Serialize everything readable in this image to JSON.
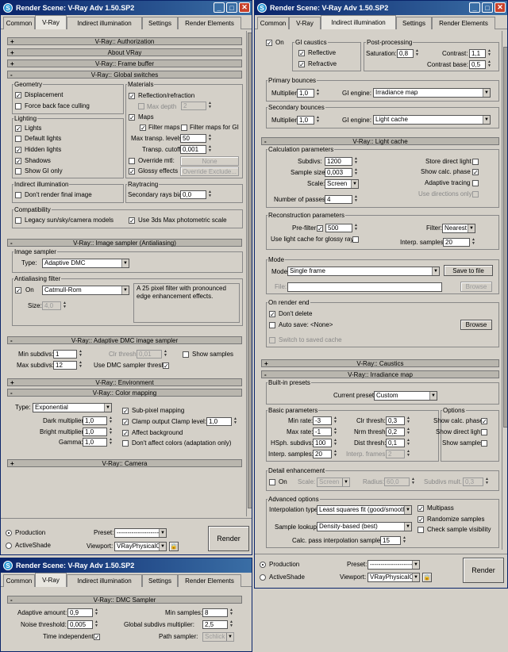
{
  "windows": {
    "title": "Render Scene: V-Ray Adv 1.50.SP2"
  },
  "tabs": [
    "Common",
    "V-Ray",
    "Indirect illumination",
    "Settings",
    "Render Elements"
  ],
  "left": {
    "rollouts": {
      "authorization": "V-Ray:: Authorization",
      "about": "About VRay",
      "framebuffer": "V-Ray:: Frame buffer",
      "global": "V-Ray:: Global switches",
      "imagesampler": "V-Ray:: Image sampler (Antialiasing)",
      "adaptive": "V-Ray:: Adaptive DMC image sampler",
      "environment": "V-Ray:: Environment",
      "colormapping": "V-Ray:: Color mapping",
      "camera": "V-Ray:: Camera"
    },
    "geometry": {
      "label": "Geometry",
      "displacement": "Displacement",
      "force_backface": "Force back face culling"
    },
    "materials": {
      "label": "Materials",
      "reflection": "Reflection/refraction",
      "max_depth": "Max depth",
      "max_depth_val": "2",
      "maps": "Maps",
      "filter_maps": "Filter maps",
      "filter_maps_gi": "Filter maps for GI",
      "max_transp_levels": "Max transp. levels",
      "max_transp_val": "50",
      "transp_cutoff": "Transp. cutoff",
      "transp_cutoff_val": "0,001",
      "override_mtl": "Override mtl:",
      "none": "None",
      "glossy": "Glossy effects",
      "override_exclude": "Override Exclude..."
    },
    "lighting": {
      "label": "Lighting",
      "lights": "Lights",
      "default_lights": "Default lights",
      "hidden_lights": "Hidden lights",
      "shadows": "Shadows",
      "show_gi_only": "Show GI only"
    },
    "indirect": {
      "label": "Indirect illumination",
      "dont_render": "Don't render final image"
    },
    "raytracing": {
      "label": "Raytracing",
      "secondary_bias": "Secondary rays bias",
      "secondary_bias_val": "0,0"
    },
    "compat": {
      "label": "Compatibility",
      "legacy": "Legacy sun/sky/camera models",
      "use_3ds": "Use 3ds Max photometric scale"
    },
    "imgsampler": {
      "label": "Image sampler",
      "type_label": "Type:",
      "type_val": "Adaptive DMC"
    },
    "aa": {
      "label": "Antialiasing filter",
      "on": "On",
      "filter": "Catmull-Rom",
      "desc": "A 25 pixel filter with pronounced edge enhancement effects.",
      "size_label": "Size:",
      "size_val": "4,0"
    },
    "adaptive": {
      "min_subdivs": "Min subdivs:",
      "min_subdivs_val": "1",
      "max_subdivs": "Max subdivs:",
      "max_subdivs_val": "12",
      "clr_thresh": "Clr thresh:",
      "clr_thresh_val": "0,01",
      "use_dmc": "Use DMC sampler thresh.",
      "show_samples": "Show samples"
    },
    "colormap": {
      "type_label": "Type:",
      "type_val": "Exponential",
      "dark": "Dark multiplier:",
      "dark_val": "1,0",
      "bright": "Bright multiplier:",
      "bright_val": "1,0",
      "gamma": "Gamma:",
      "gamma_val": "1,0",
      "subpixel": "Sub-pixel mapping",
      "clamp": "Clamp output",
      "clamp_level": "Clamp level:",
      "clamp_level_val": "1,0",
      "affect_bg": "Affect background",
      "dont_affect": "Don't affect colors (adaptation only)"
    }
  },
  "bottom": {
    "production": "Production",
    "activeshade": "ActiveShade",
    "preset": "Preset:",
    "preset_val": "---------------------------",
    "viewport": "Viewport:",
    "viewport_val": "VRayPhysicalC",
    "render": "Render"
  },
  "dmc": {
    "rollout": "V-Ray:: DMC Sampler",
    "adaptive_amount": "Adaptive amount:",
    "adaptive_amount_val": "0,9",
    "noise_threshold": "Noise threshold:",
    "noise_threshold_val": "0,005",
    "time_independent": "Time independent",
    "min_samples": "Min samples:",
    "min_samples_val": "8",
    "global_subdivs": "Global subdivs multiplier:",
    "global_subdivs_val": "2,5",
    "path_sampler": "Path sampler:",
    "path_sampler_val": "Schlick sampling"
  },
  "right": {
    "on": "On",
    "gi_caustics": {
      "label": "GI caustics",
      "reflective": "Reflective",
      "refractive": "Refractive"
    },
    "post": {
      "label": "Post-processing",
      "saturation": "Saturation:",
      "saturation_val": "0,8",
      "contrast": "Contrast:",
      "contrast_val": "1,1",
      "contrast_base": "Contrast base:",
      "contrast_base_val": "0,5"
    },
    "primary": {
      "label": "Primary bounces",
      "multiplier": "Multiplier:",
      "multiplier_val": "1,0",
      "gi_engine": "GI engine:",
      "engine_val": "Irradiance map"
    },
    "secondary": {
      "label": "Secondary bounces",
      "multiplier": "Multiplier:",
      "multiplier_val": "1,0",
      "gi_engine": "GI engine:",
      "engine_val": "Light cache"
    },
    "lightcache": {
      "rollout": "V-Ray:: Light cache",
      "calc_label": "Calculation parameters",
      "subdivs": "Subdivs:",
      "subdivs_val": "1200",
      "sample_size": "Sample size:",
      "sample_size_val": "0,003",
      "scale": "Scale:",
      "scale_val": "Screen",
      "num_passes": "Number of passes:",
      "num_passes_val": "4",
      "store_direct": "Store direct light",
      "show_calc": "Show calc. phase",
      "adaptive_tracing": "Adaptive tracing",
      "use_directions": "Use directions only",
      "recon_label": "Reconstruction parameters",
      "prefilter": "Pre-filter:",
      "prefilter_val": "500",
      "use_lc_glossy": "Use light cache for glossy rays",
      "filter": "Filter:",
      "filter_val": "Nearest",
      "interp_samples": "Interp. samples:",
      "interp_samples_val": "20",
      "mode_label": "Mode",
      "mode": "Mode:",
      "mode_val": "Single frame",
      "save_to_file": "Save to file",
      "file": "File:",
      "browse": "Browse",
      "on_end_label": "On render end",
      "dont_delete": "Don't delete",
      "auto_save": "Auto save:",
      "auto_save_val": "<None>",
      "switch_saved": "Switch to saved cache"
    },
    "caustics_rollout": "V-Ray:: Caustics",
    "irradiance": {
      "rollout": "V-Ray:: Irradiance map",
      "builtin_label": "Built-in presets",
      "current_preset": "Current preset:",
      "preset_val": "Custom",
      "basic_label": "Basic parameters",
      "min_rate": "Min rate:",
      "min_rate_val": "-3",
      "max_rate": "Max rate:",
      "max_rate_val": "-1",
      "hsph": "HSph. subdivs:",
      "hsph_val": "100",
      "interp_samples": "Interp. samples:",
      "interp_samples_val": "20",
      "clr_thresh": "Clr thresh:",
      "clr_thresh_val": "0,3",
      "nrm_thresh": "Nrm thresh:",
      "nrm_thresh_val": "0,2",
      "dist_thresh": "Dist thresh:",
      "dist_thresh_val": "0,1",
      "interp_frames": "Interp. frames:",
      "interp_frames_val": "2",
      "options_label": "Options",
      "show_calc": "Show calc. phase",
      "show_direct": "Show direct light",
      "show_samples": "Show samples",
      "detail_label": "Detail enhancement",
      "on": "On",
      "scale": "Scale:",
      "scale_val": "Screen",
      "radius": "Radius:",
      "radius_val": "60,0",
      "subdivs_mult": "Subdivs mult.",
      "subdivs_mult_val": "0,3",
      "adv_label": "Advanced options",
      "interp_type": "Interpolation type:",
      "interp_type_val": "Least squares fit (good/smooth",
      "sample_lookup": "Sample lookup:",
      "sample_lookup_val": "Density-based (best)",
      "calc_pass": "Calc. pass interpolation samples:",
      "calc_pass_val": "15",
      "multipass": "Multipass",
      "randomize": "Randomize samples",
      "check_vis": "Check sample visibility"
    }
  }
}
